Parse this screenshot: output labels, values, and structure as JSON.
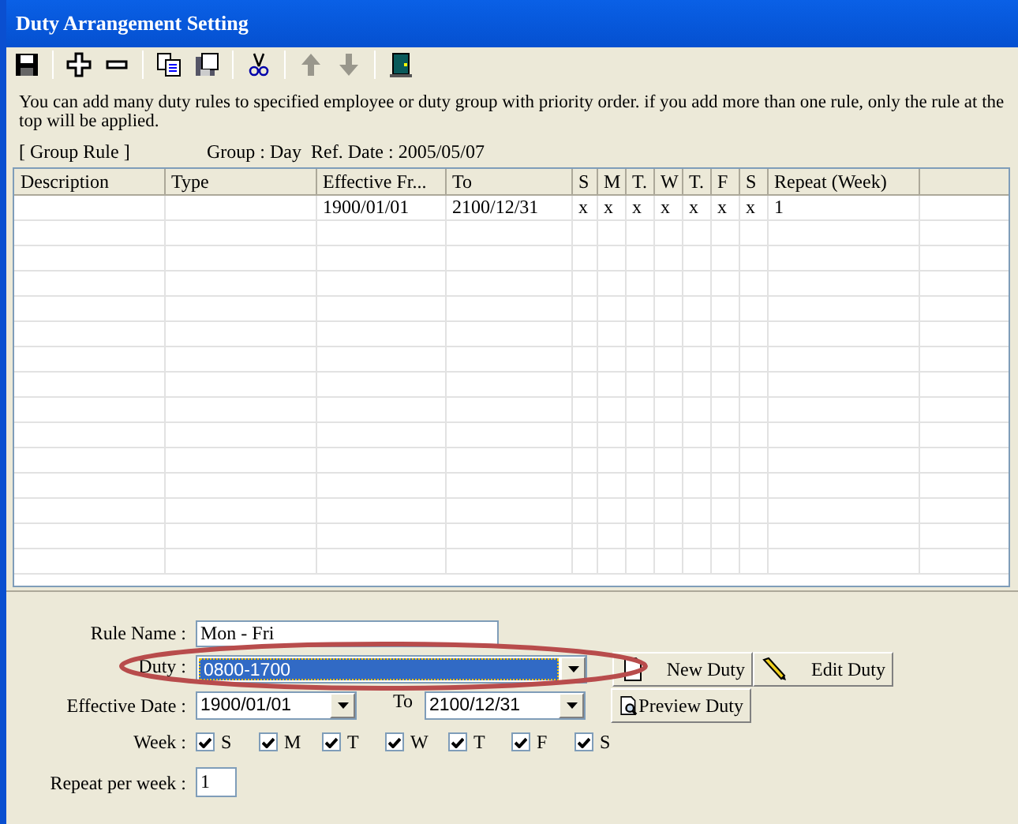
{
  "window": {
    "title": "Duty Arrangement Setting"
  },
  "toolbar": [
    {
      "kind": "save",
      "disabled": false
    },
    {
      "kind": "sep"
    },
    {
      "kind": "add",
      "disabled": false
    },
    {
      "kind": "remove",
      "disabled": false
    },
    {
      "kind": "sep"
    },
    {
      "kind": "copy",
      "disabled": false
    },
    {
      "kind": "paste",
      "disabled": false
    },
    {
      "kind": "sep"
    },
    {
      "kind": "cut",
      "disabled": false
    },
    {
      "kind": "sep"
    },
    {
      "kind": "up",
      "disabled": true
    },
    {
      "kind": "down",
      "disabled": true
    },
    {
      "kind": "sep"
    },
    {
      "kind": "exit",
      "disabled": false
    }
  ],
  "description": "You can add many duty rules to specified employee or duty group with priority order. if you add more than one rule, only the rule at the top will be applied.",
  "scope": "[ Group Rule ]",
  "group": "Group : Day",
  "ref_date": "Ref. Date : 2005/05/07",
  "table": {
    "columns": [
      "Description",
      "Type",
      "Effective Fr...",
      "To",
      "S",
      "M",
      "T.",
      "W",
      "T.",
      "F",
      "S",
      "Repeat (Week)"
    ],
    "rows": [
      {
        "effective_from": "1900/01/01",
        "to": "2100/12/31",
        "days": [
          "x",
          "x",
          "x",
          "x",
          "x",
          "x",
          "x"
        ],
        "repeat": "1",
        "selected": false
      }
    ]
  },
  "form": {
    "rule_name_label": "Rule Name :",
    "rule_name": "Mon - Fri",
    "duty_label": "Duty :",
    "duty": "0800-1700",
    "duty_selected": true,
    "date_label": "Effective Date :",
    "date_from": "1900/01/01",
    "to_label": "To",
    "date_to": "2100/12/31",
    "week_label": "Week :",
    "days": [
      {
        "label": "S",
        "checked": true
      },
      {
        "label": "M",
        "checked": true
      },
      {
        "label": "T",
        "checked": true
      },
      {
        "label": "W",
        "checked": true
      },
      {
        "label": "T",
        "checked": true
      },
      {
        "label": "F",
        "checked": true
      },
      {
        "label": "S",
        "checked": true
      }
    ],
    "repeat_label": "Repeat per week :",
    "repeat": "1"
  },
  "buttons": [
    {
      "kind": "new",
      "label": "New Duty"
    },
    {
      "kind": "edit",
      "label": "Edit Duty"
    },
    {
      "kind": "preview",
      "label": "Preview Duty"
    }
  ]
}
